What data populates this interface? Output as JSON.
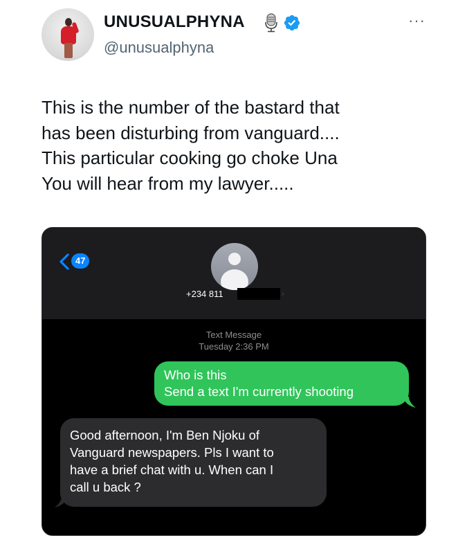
{
  "author": {
    "display_name": "UNUSUALPHYNA",
    "handle": "@unusualphyna",
    "more_label": "···"
  },
  "tweet": {
    "lines": [
      "This is the number of the bastard that",
      "has been disturbing from vanguard....",
      "This particular cooking go choke Una",
      "You will hear from my lawyer....."
    ]
  },
  "imessage": {
    "back_count": "47",
    "contact_number": "+234 811",
    "meta_line1": "Text Message",
    "meta_line2": "Tuesday 2:36 PM",
    "outgoing_lines": [
      "Who is this",
      "Send a text I'm currently shooting"
    ],
    "incoming_lines": [
      "Good afternoon, I'm Ben Njoku of",
      "Vanguard newspapers. Pls I want to",
      "have a brief chat with u. When can I",
      "call u back ?"
    ],
    "colors": {
      "outgoing_bubble": "#30c45a",
      "incoming_bubble": "#2c2c2e",
      "accent": "#0a84ff"
    }
  },
  "colors": {
    "verified": "#1d9bf0",
    "secondary_text": "#536471"
  },
  "icons": [
    "avatar",
    "microphone-icon",
    "verified-badge-icon",
    "more-icon",
    "back-chevron-icon",
    "contact-avatar"
  ]
}
